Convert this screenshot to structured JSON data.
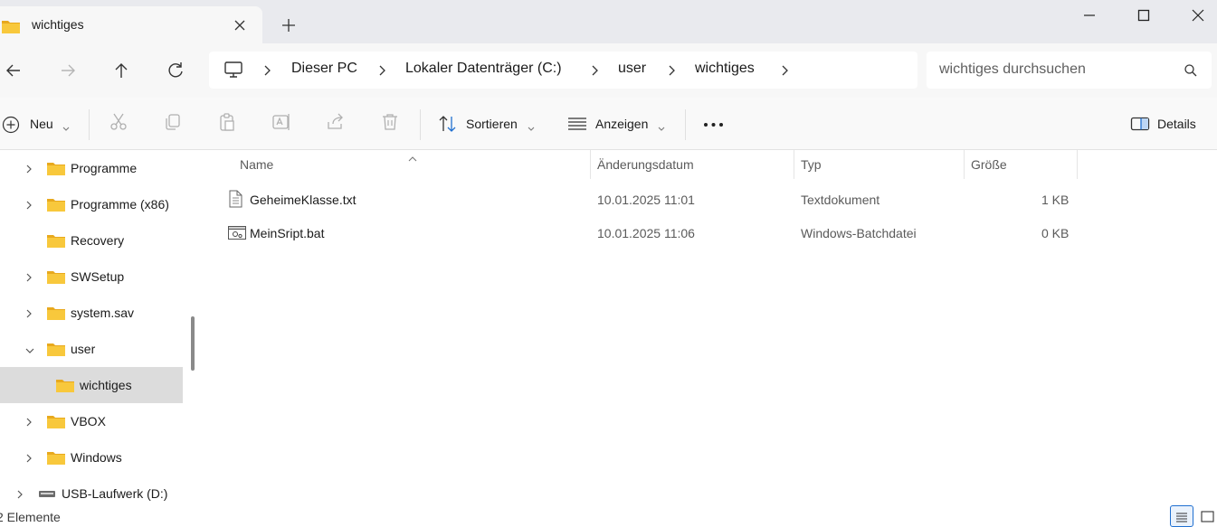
{
  "window": {
    "tab_title": "wichtiges",
    "icons": {
      "folder": "folder-icon",
      "close": "close-icon",
      "new_tab": "plus-icon",
      "minimize": "minimize-icon",
      "maximize": "maximize-icon",
      "close_window": "close-icon"
    }
  },
  "address": {
    "breadcrumbs": [
      "Dieser PC",
      "Lokaler Datenträger (C:)",
      "user",
      "wichtiges"
    ],
    "search_placeholder": "wichtiges durchsuchen"
  },
  "toolbar": {
    "new_label": "Neu",
    "sort_label": "Sortieren",
    "view_label": "Anzeigen",
    "more_label": "•••",
    "details_label": "Details",
    "icons": [
      "cut-icon",
      "copy-icon",
      "paste-icon",
      "rename-icon",
      "share-icon",
      "delete-icon"
    ]
  },
  "nav": {
    "items": [
      {
        "label": "Programme",
        "expander": ">",
        "level": 1
      },
      {
        "label": "Programme (x86)",
        "expander": ">",
        "level": 1
      },
      {
        "label": "Recovery",
        "expander": "",
        "level": 1
      },
      {
        "label": "SWSetup",
        "expander": ">",
        "level": 1
      },
      {
        "label": "system.sav",
        "expander": ">",
        "level": 1
      },
      {
        "label": "user",
        "expander": "v",
        "level": 1
      },
      {
        "label": "wichtiges",
        "expander": "",
        "level": 2,
        "selected": true
      },
      {
        "label": "VBOX",
        "expander": ">",
        "level": 1
      },
      {
        "label": "Windows",
        "expander": ">",
        "level": 1
      },
      {
        "label": "USB-Laufwerk (D:)",
        "expander": ">",
        "level": 0
      }
    ]
  },
  "files": {
    "columns": [
      "Name",
      "Änderungsdatum",
      "Typ",
      "Größe"
    ],
    "rows": [
      {
        "name": "GeheimeKlasse.txt",
        "date": "10.01.2025 11:01",
        "type": "Textdokument",
        "size": "1 KB",
        "icon": "text-file-icon"
      },
      {
        "name": "MeinSript.bat",
        "date": "10.01.2025 11:06",
        "type": "Windows-Batchdatei",
        "size": "0 KB",
        "icon": "batch-file-icon"
      }
    ]
  },
  "status": {
    "count_text": "2 Elemente"
  },
  "colors": {
    "folder_yellow": "#f8c83c",
    "folder_dark": "#e8a91e",
    "selection": "#dcdcdc",
    "accent": "#1f6fd0"
  }
}
